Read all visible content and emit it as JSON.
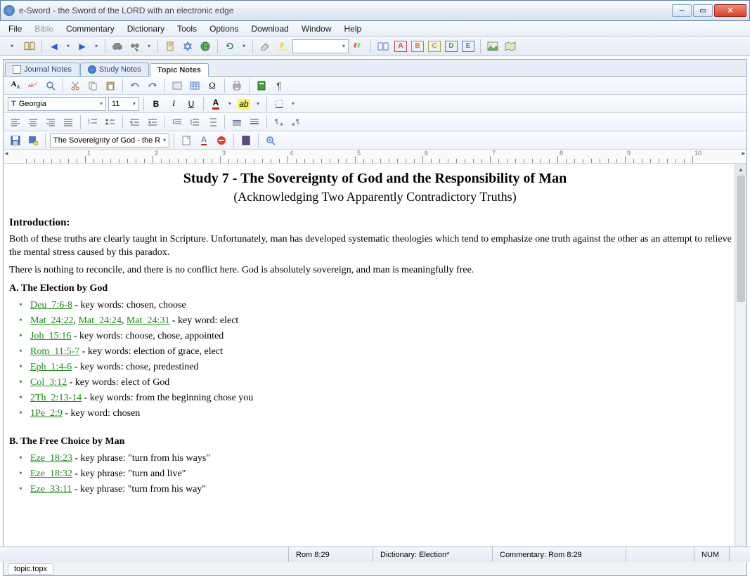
{
  "title": "e-Sword - the Sword of the LORD with an electronic edge",
  "menu": [
    "File",
    "Bible",
    "Commentary",
    "Dictionary",
    "Tools",
    "Options",
    "Download",
    "Window",
    "Help"
  ],
  "menu_disabled": [
    1
  ],
  "markbtns": [
    "A",
    "B",
    "C",
    "D",
    "E"
  ],
  "tabs": [
    {
      "label": "Journal Notes",
      "active": false,
      "icon": "doc"
    },
    {
      "label": "Study Notes",
      "active": false,
      "icon": "blue"
    },
    {
      "label": "Topic Notes",
      "active": true,
      "icon": "none"
    }
  ],
  "font": {
    "name": "Georgia",
    "size": "11"
  },
  "topic_dropdown": "The Sovereignty of God - the R",
  "doc": {
    "title": "Study 7 - The Sovereignty of God and the Responsibility of Man",
    "subtitle": "(Acknowledging Two Apparently Contradictory Truths)",
    "intro_head": "Introduction:",
    "intro_p1": "Both of these truths are clearly taught in Scripture.  Unfortunately, man has developed systematic theologies which tend to emphasize one truth against the other as an attempt to relieve the mental stress caused by this paradox.",
    "intro_p2": "There is nothing to reconcile, and there is no conflict here.  God is absolutely sovereign, and man is meaningfully free.",
    "sectA_head": "A.  The Election by God",
    "sectA": [
      {
        "refs": [
          "Deu_7:6-8"
        ],
        "text": " - key words: chosen, choose"
      },
      {
        "refs": [
          "Mat_24:22",
          "Mat_24:24",
          "Mat_24:31"
        ],
        "text": " - key word: elect"
      },
      {
        "refs": [
          "Joh_15:16"
        ],
        "text": " - key words: choose, chose, appointed"
      },
      {
        "refs": [
          "Rom_11:5-7"
        ],
        "text": " - key words: election of grace, elect"
      },
      {
        "refs": [
          "Eph_1:4-6"
        ],
        "text": " - key words: chose, predestined"
      },
      {
        "refs": [
          "Col_3:12"
        ],
        "text": " - key words: elect of God"
      },
      {
        "refs": [
          "2Th_2:13-14"
        ],
        "text": " - key words: from the beginning chose you"
      },
      {
        "refs": [
          "1Pe_2:9"
        ],
        "text": " - key word: chosen"
      }
    ],
    "sectB_head": "B.  The Free Choice by Man",
    "sectB": [
      {
        "refs": [
          "Eze_18:23"
        ],
        "text": " - key phrase: \"turn from his ways\""
      },
      {
        "refs": [
          "Eze_18:32"
        ],
        "text": " - key phrase: \"turn and live\""
      },
      {
        "refs": [
          "Eze_33:11"
        ],
        "text": " - key phrase: \"turn from his way\""
      }
    ]
  },
  "footer_tab": "topic.topx",
  "status": {
    "ref": "Rom 8:29",
    "dict": "Dictionary: Election*",
    "comm": "Commentary: Rom 8:29",
    "num": "NUM"
  },
  "ruler_marks": [
    "1",
    "2",
    "3",
    "4",
    "5",
    "6",
    "7",
    "8",
    "9",
    "10"
  ]
}
